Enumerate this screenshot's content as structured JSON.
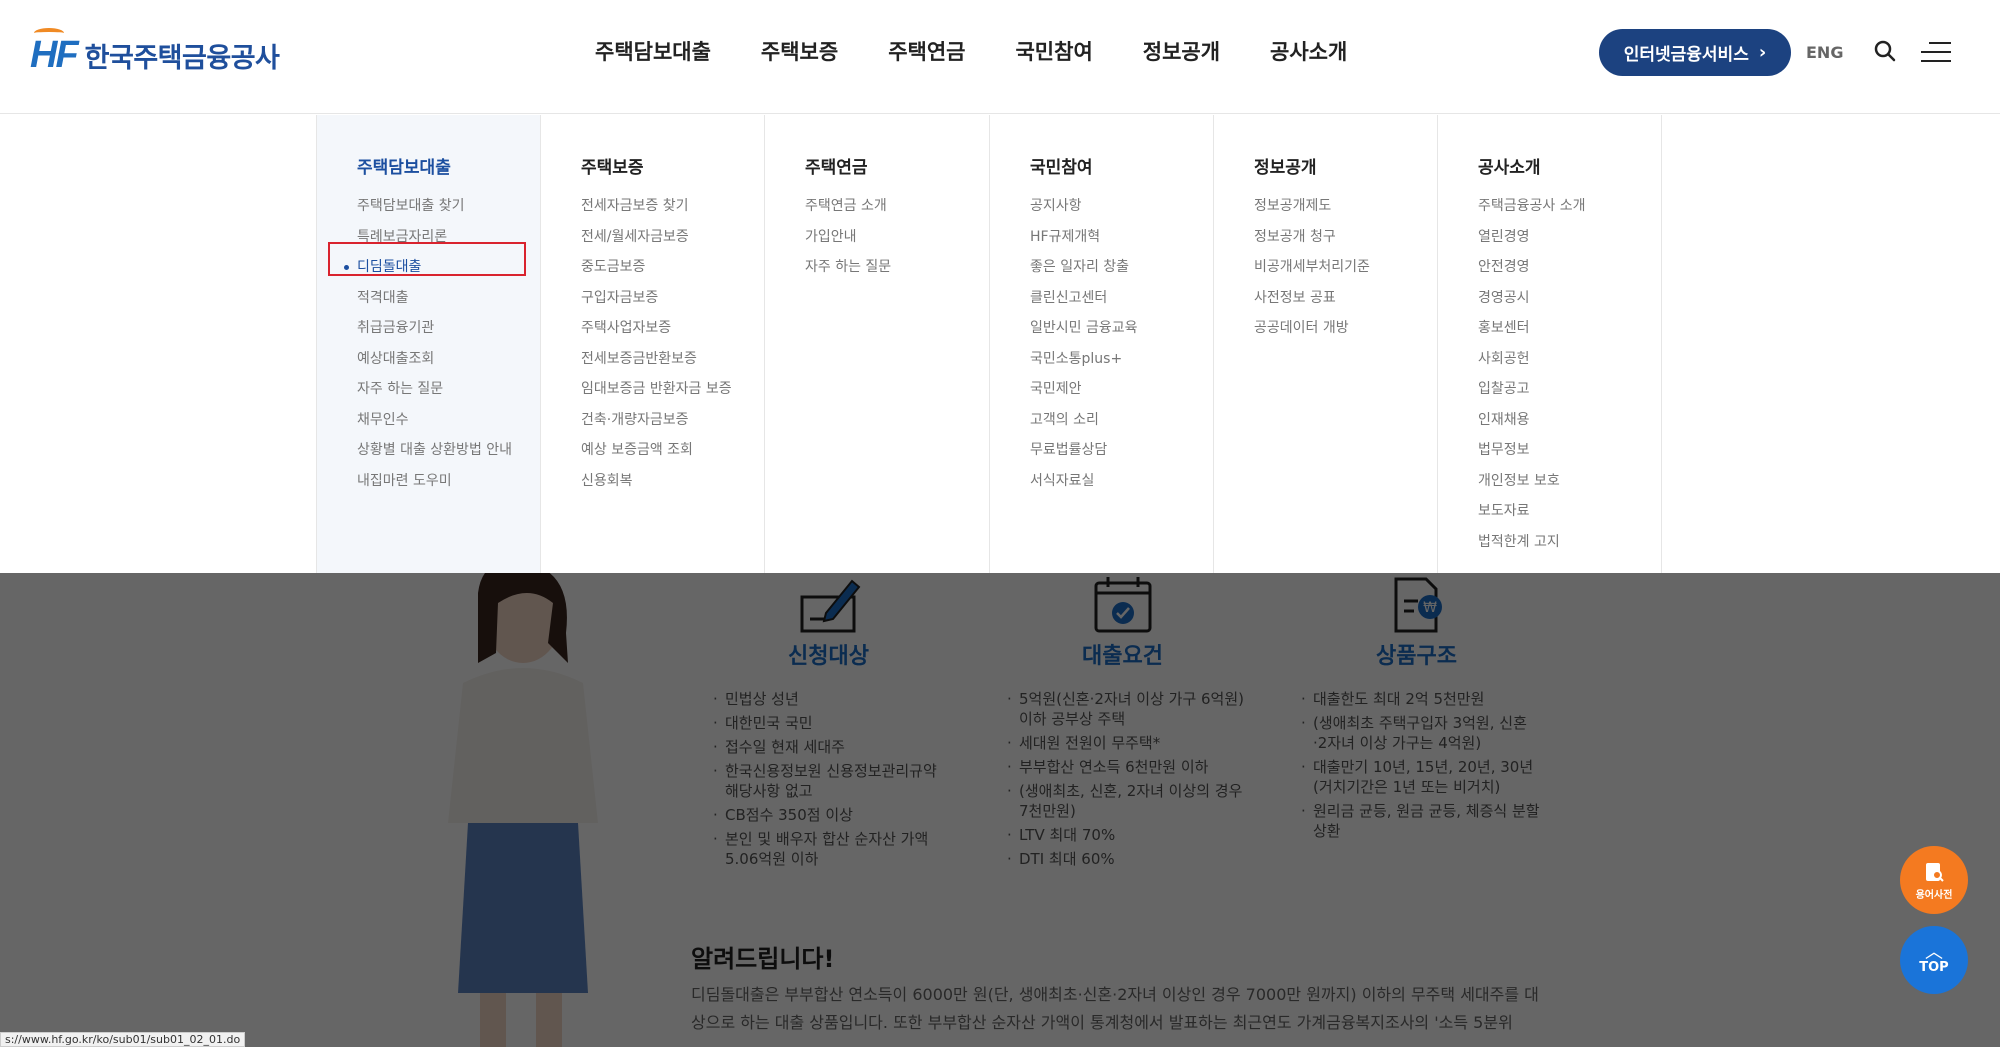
{
  "header": {
    "logo_mark": "HF",
    "logo_text": "한국주택금융공사",
    "nav": [
      "주택담보대출",
      "주택보증",
      "주택연금",
      "국민참여",
      "정보공개",
      "공사소개"
    ],
    "internet_btn": "인터넷금융서비스",
    "lang": "ENG"
  },
  "mega": {
    "columns": [
      {
        "title": "주택담보대출",
        "items": [
          "주택담보대출 찾기",
          "특례보금자리론",
          "디딤돌대출",
          "적격대출",
          "취급금융기관",
          "예상대출조회",
          "자주 하는 질문",
          "채무인수",
          "상황별 대출 상환방법 안내",
          "내집마련 도우미"
        ]
      },
      {
        "title": "주택보증",
        "items": [
          "전세자금보증 찾기",
          "전세/월세자금보증",
          "중도금보증",
          "구입자금보증",
          "주택사업자보증",
          "전세보증금반환보증",
          "임대보증금 반환자금 보증",
          "건축·개량자금보증",
          "예상 보증금액 조회",
          "신용회복"
        ]
      },
      {
        "title": "주택연금",
        "items": [
          "주택연금 소개",
          "가입안내",
          "자주 하는 질문"
        ]
      },
      {
        "title": "국민참여",
        "items": [
          "공지사항",
          "HF규제개혁",
          "좋은 일자리 창출",
          "클린신고센터",
          "일반시민 금융교육",
          "국민소통plus+",
          "국민제안",
          "고객의 소리",
          "무료법률상담",
          "서식자료실"
        ]
      },
      {
        "title": "정보공개",
        "items": [
          "정보공개제도",
          "정보공개 청구",
          "비공개세부처리기준",
          "사전정보 공표",
          "공공데이터 개방"
        ]
      },
      {
        "title": "공사소개",
        "items": [
          "주택금융공사 소개",
          "열린경영",
          "안전경영",
          "경영공시",
          "홍보센터",
          "사회공헌",
          "입찰공고",
          "인재채용",
          "법무정보",
          "개인정보 보호",
          "보도자료",
          "법적한계 고지"
        ]
      }
    ]
  },
  "cards": [
    {
      "title": "신청대상",
      "icon": "pen-document-icon",
      "items": [
        "민법상 성년",
        "대한민국 국민",
        "접수일 현재 세대주",
        "한국신용정보원 신용정보관리규약 해당사항 없고",
        "CB점수 350점 이상",
        "본인 및 배우자 합산 순자산 가액 5.06억원 이하"
      ]
    },
    {
      "title": "대출요건",
      "icon": "calendar-check-icon",
      "items": [
        "5억원(신혼·2자녀 이상 가구 6억원) 이하 공부상 주택",
        "세대원 전원이 무주택*",
        "부부합산 연소득 6천만원 이하",
        "(생애최초, 신혼, 2자녀 이상의 경우 7천만원)",
        "LTV 최대 70%",
        "DTI 최대 60%"
      ]
    },
    {
      "title": "상품구조",
      "icon": "won-document-icon",
      "items": [
        "대출한도 최대 2억 5천만원",
        "(생애최초 주택구입자 3억원, 신혼·2자녀 이상 가구는 4억원)",
        "대출만기 10년, 15년, 20년, 30년 (거치기간은 1년 또는 비거치)",
        "원리금 균등, 원금 균등, 체증식 분할상환"
      ]
    }
  ],
  "notice": {
    "title": "알려드립니다!",
    "text": "디딤돌대출은 부부합산 연소득이 6000만 원(단, 생애최초·신혼·2자녀 이상인 경우 7000만 원까지) 이하의 무주택 세대주를 대상으로 하는 대출 상품입니다. 또한 부부합산 순자산 가액이 통계청에서 발표하는 최근연도 가계금융복지조사의 '소득 5분위"
  },
  "floating": {
    "dict_label": "용어사전",
    "top_label": "TOP"
  },
  "status_url": "s://www.hf.go.kr/ko/sub01/sub01_02_01.do"
}
